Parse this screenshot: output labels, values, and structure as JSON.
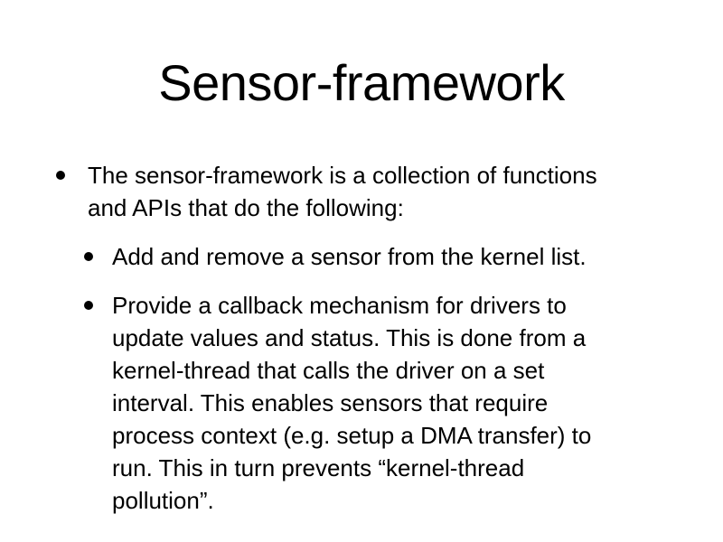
{
  "slide": {
    "title": "Sensor-framework",
    "bullets": [
      {
        "text": "The sensor-framework is a collection of functions\nand APIs that do the following:"
      }
    ],
    "sub_bullets": [
      {
        "text": "Add and remove a sensor from the kernel list."
      },
      {
        "text": "Provide a callback mechanism for drivers to\nupdate values and status. This is done from a\nkernel-thread that calls the driver on a set\ninterval. This enables sensors that require\nprocess context (e.g. setup a DMA transfer) to\nrun. This in turn prevents “kernel-thread\npollution”."
      }
    ]
  }
}
